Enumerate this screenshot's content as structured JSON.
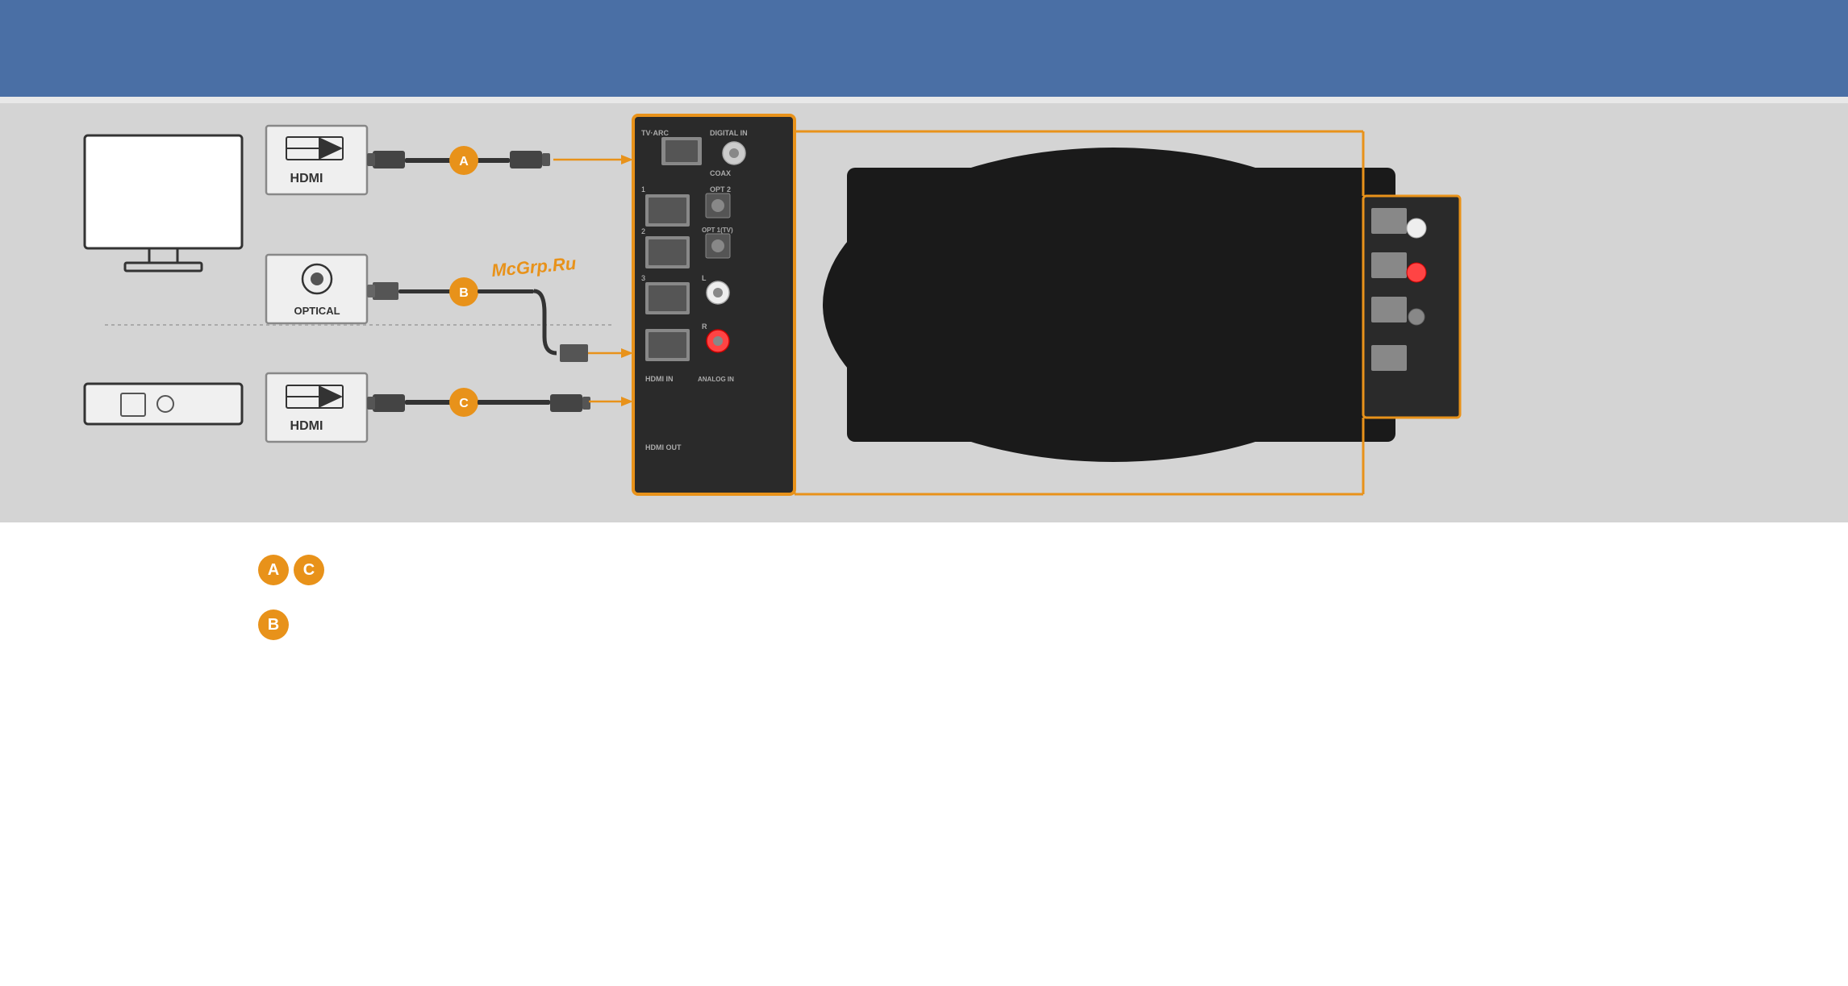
{
  "page": {
    "top_banner_color": "#4a6fa5",
    "separator_color": "#cccccc",
    "diagram_bg": "#d4d4d4",
    "text_bg": "#ffffff"
  },
  "diagram": {
    "watermark": "McG rp.Ru",
    "watermark_text": "McGrp.Ru",
    "panel_labels": {
      "digital_in": "DIGITAL IN",
      "hdmi_out": "HDMI OUT",
      "coax": "COAX",
      "opt2": "OPT 2",
      "opt1_tv": "OPT 1(TV)",
      "hdmi_in": "HDMI IN",
      "analog_in": "ANALOG IN",
      "tv_arc": "TV-ARC"
    },
    "connection_badges": {
      "a": "A",
      "b": "B",
      "c": "C"
    },
    "cable_types": {
      "a": "HDMI",
      "b": "Optical",
      "c": "HDMI"
    },
    "devices": {
      "top_left": "TV",
      "bottom_left": "Blu-ray / Set-top box",
      "top_label": "HDMI",
      "bottom_label": "HDMI"
    }
  },
  "instructions": {
    "row_ac": {
      "badges": [
        "A",
        "C"
      ],
      "text": ""
    },
    "row_b": {
      "badges": [
        "B"
      ],
      "text": ""
    }
  },
  "colors": {
    "orange": "#e8921a",
    "dark_panel": "#2d2d2d",
    "cable_dark": "#3a3a3a",
    "text_dark": "#333333",
    "badge_orange": "#e8921a"
  }
}
